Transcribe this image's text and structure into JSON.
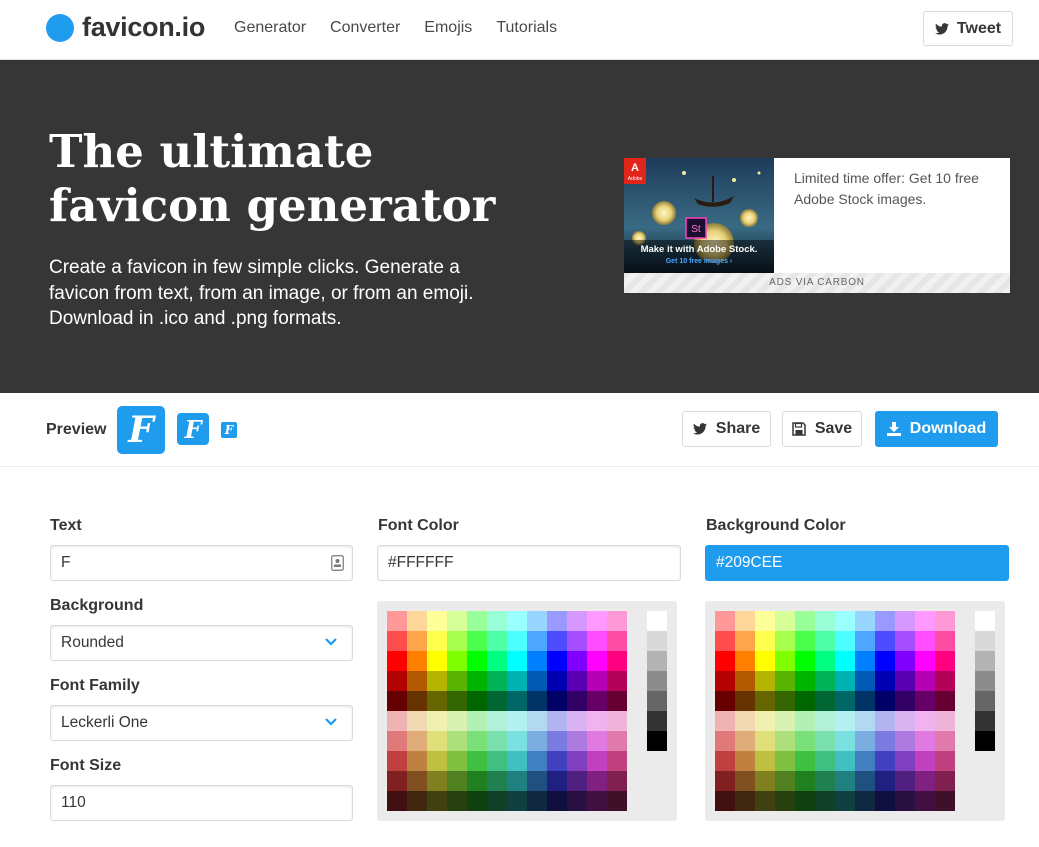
{
  "brand": {
    "name": "favicon.io",
    "accent": "#209CEE"
  },
  "nav": {
    "links": [
      "Generator",
      "Converter",
      "Emojis",
      "Tutorials"
    ],
    "tweet_label": "Tweet"
  },
  "hero": {
    "title": "The ultimate favicon generator",
    "subtitle": "Create a favicon in few simple clicks. Generate a favicon from text, from an image, or from an emoji. Download in .ico and .png formats.",
    "background": "#363636"
  },
  "ad": {
    "image_caption": "Make it with Adobe Stock.",
    "image_cta": "Get 10 free images ›",
    "text": "Limited time offer: Get 10 free Adobe Stock images.",
    "footer": "ADS VIA CARBON"
  },
  "preview": {
    "label": "Preview",
    "glyph": "F",
    "share_label": "Share",
    "save_label": "Save",
    "download_label": "Download"
  },
  "form": {
    "text_label": "Text",
    "text_value": "F",
    "background_label": "Background",
    "background_value": "Rounded",
    "font_family_label": "Font Family",
    "font_family_value": "Leckerli One",
    "font_size_label": "Font Size",
    "font_size_value": "110",
    "font_color_label": "Font Color",
    "font_color_value": "#FFFFFF",
    "bg_color_label": "Background Color",
    "bg_color_value": "#209CEE"
  },
  "palette": {
    "rows": [
      [
        "#ff9999",
        "#ffd699",
        "#ffff99",
        "#d6ff99",
        "#99ff99",
        "#99ffd6",
        "#99ffff",
        "#99d6ff",
        "#9999ff",
        "#d699ff",
        "#ff99ff",
        "#ff99d6"
      ],
      [
        "#ff4d4d",
        "#ffa64d",
        "#ffff4d",
        "#a6ff4d",
        "#4dff4d",
        "#4dffa6",
        "#4dffff",
        "#4da6ff",
        "#4d4dff",
        "#a64dff",
        "#ff4dff",
        "#ff4da6"
      ],
      [
        "#ff0000",
        "#ff8000",
        "#ffff00",
        "#80ff00",
        "#00ff00",
        "#00ff80",
        "#00ffff",
        "#0080ff",
        "#0000ff",
        "#8000ff",
        "#ff00ff",
        "#ff0080"
      ],
      [
        "#b30000",
        "#b35900",
        "#b3b300",
        "#59b300",
        "#00b300",
        "#00b359",
        "#00b3b3",
        "#0059b3",
        "#0000b3",
        "#5900b3",
        "#b300b3",
        "#b30059"
      ],
      [
        "#660000",
        "#663300",
        "#666600",
        "#336600",
        "#006600",
        "#006633",
        "#006666",
        "#003366",
        "#000066",
        "#330066",
        "#660066",
        "#660033"
      ],
      [
        "#f0b3b3",
        "#f0d9b3",
        "#f0f0b3",
        "#d9f0b3",
        "#b3f0b3",
        "#b3f0d9",
        "#b3f0f0",
        "#b3d9f0",
        "#b3b3f0",
        "#d9b3f0",
        "#f0b3f0",
        "#f0b3d9"
      ],
      [
        "#e07a7a",
        "#e0ad7a",
        "#e0e07a",
        "#ade07a",
        "#7ae07a",
        "#7ae0ad",
        "#7ae0e0",
        "#7aade0",
        "#7a7ae0",
        "#ad7ae0",
        "#e07ae0",
        "#e07aad"
      ],
      [
        "#c04040",
        "#c08040",
        "#c0c040",
        "#80c040",
        "#40c040",
        "#40c080",
        "#40c0c0",
        "#4080c0",
        "#4040c0",
        "#8040c0",
        "#c040c0",
        "#c04080"
      ],
      [
        "#802020",
        "#805020",
        "#808020",
        "#508020",
        "#208020",
        "#208050",
        "#208080",
        "#205080",
        "#202080",
        "#502080",
        "#802080",
        "#802050"
      ],
      [
        "#401010",
        "#402810",
        "#404010",
        "#284010",
        "#104010",
        "#104028",
        "#104040",
        "#102840",
        "#101040",
        "#281040",
        "#401040",
        "#401028"
      ]
    ],
    "grays": [
      "#ffffff",
      "#d9d9d9",
      "#b3b3b3",
      "#8c8c8c",
      "#666666",
      "#333333",
      "#000000"
    ]
  }
}
